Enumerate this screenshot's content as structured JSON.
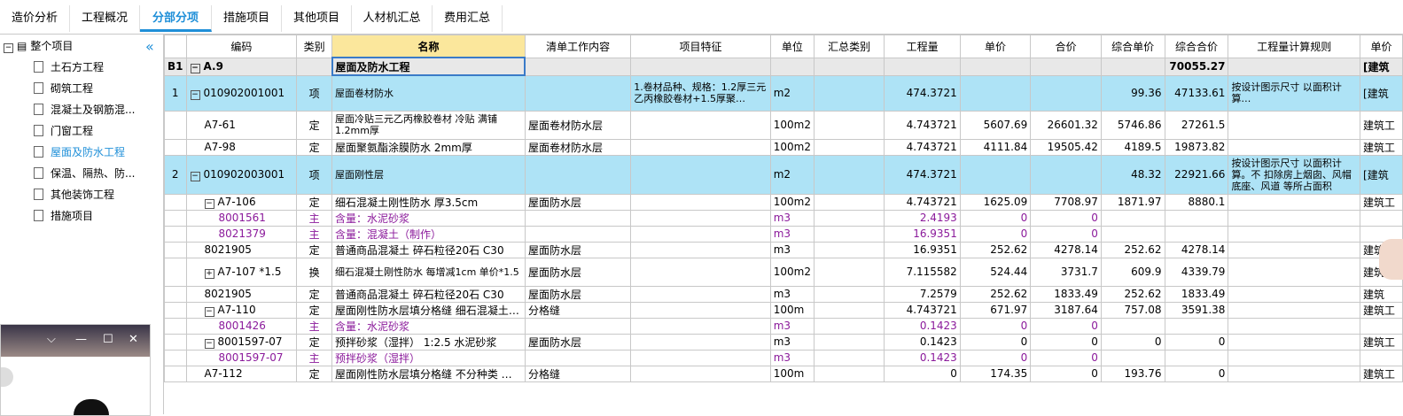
{
  "tabs": [
    "造价分析",
    "工程概况",
    "分部分项",
    "措施项目",
    "其他项目",
    "人材机汇总",
    "费用汇总"
  ],
  "active_tab": "分部分项",
  "tree": {
    "root": "整个项目",
    "items": [
      "土石方工程",
      "砌筑工程",
      "混凝土及钢筋混...",
      "门窗工程",
      "屋面及防水工程",
      "保温、隔热、防...",
      "其他装饰工程",
      "措施项目"
    ],
    "selected": "屋面及防水工程"
  },
  "columns": [
    "",
    "编码",
    "类别",
    "名称",
    "清单工作内容",
    "项目特征",
    "单位",
    "汇总类别",
    "工程量",
    "单价",
    "合价",
    "综合单价",
    "综合合价",
    "工程量计算规则",
    "单价"
  ],
  "rows": [
    {
      "idx": "B1",
      "code": "A.9",
      "type": "",
      "name": "屋面及防水工程",
      "work": "",
      "feature": "",
      "unit": "",
      "sum": "",
      "qty": "",
      "price": "",
      "total": "",
      "cprice": "",
      "ctotal": "70055.27",
      "rule": "",
      "extra": "[建筑"
    },
    {
      "idx": "1",
      "code": "010902001001",
      "type": "项",
      "name": "屋面卷材防水",
      "work": "",
      "feature": "1.卷材品种、规格：1.2厚三元乙丙橡胶卷材+1.5厚聚…",
      "unit": "m2",
      "sum": "",
      "qty": "474.3721",
      "price": "",
      "total": "",
      "cprice": "99.36",
      "ctotal": "47133.61",
      "rule": "按设计图示尺寸 以面积计算…",
      "extra": "[建筑"
    },
    {
      "idx": "",
      "code": "A7-61",
      "type": "定",
      "name": "屋面冷贴三元乙丙橡胶卷材 冷贴 满铺 1.2mm厚",
      "work": "屋面卷材防水层",
      "feature": "",
      "unit": "100m2",
      "sum": "",
      "qty": "4.743721",
      "price": "5607.69",
      "total": "26601.32",
      "cprice": "5746.86",
      "ctotal": "27261.5",
      "rule": "",
      "extra": "建筑工"
    },
    {
      "idx": "",
      "code": "A7-98",
      "type": "定",
      "name": "屋面聚氨酯涂膜防水 2mm厚",
      "work": "屋面卷材防水层",
      "feature": "",
      "unit": "100m2",
      "sum": "",
      "qty": "4.743721",
      "price": "4111.84",
      "total": "19505.42",
      "cprice": "4189.5",
      "ctotal": "19873.82",
      "rule": "",
      "extra": "建筑工"
    },
    {
      "idx": "2",
      "code": "010902003001",
      "type": "项",
      "name": "屋面刚性层",
      "work": "",
      "feature": "",
      "unit": "m2",
      "sum": "",
      "qty": "474.3721",
      "price": "",
      "total": "",
      "cprice": "48.32",
      "ctotal": "22921.66",
      "rule": "按设计图示尺寸 以面积计算。不 扣除房上烟囱、风帽底座、风道 等所占面积",
      "extra": "[建筑"
    },
    {
      "idx": "",
      "code": "A7-106",
      "type": "定",
      "name": "细石混凝土刚性防水 厚3.5cm",
      "work": "屋面防水层",
      "feature": "",
      "unit": "100m2",
      "sum": "",
      "qty": "4.743721",
      "price": "1625.09",
      "total": "7708.97",
      "cprice": "1871.97",
      "ctotal": "8880.1",
      "rule": "",
      "extra": "建筑工"
    },
    {
      "idx": "",
      "code": "8001561",
      "type": "主",
      "name": "含量：水泥砂浆",
      "work": "",
      "feature": "",
      "unit": "m3",
      "sum": "",
      "qty": "2.4193",
      "price": "0",
      "total": "0",
      "cprice": "",
      "ctotal": "",
      "rule": "",
      "extra": ""
    },
    {
      "idx": "",
      "code": "8021379",
      "type": "主",
      "name": "含量：混凝土（制作）",
      "work": "",
      "feature": "",
      "unit": "m3",
      "sum": "",
      "qty": "16.9351",
      "price": "0",
      "total": "0",
      "cprice": "",
      "ctotal": "",
      "rule": "",
      "extra": ""
    },
    {
      "idx": "",
      "code": "8021905",
      "type": "定",
      "name": "普通商品混凝土 碎石粒径20石 C30",
      "work": "屋面防水层",
      "feature": "",
      "unit": "m3",
      "sum": "",
      "qty": "16.9351",
      "price": "252.62",
      "total": "4278.14",
      "cprice": "252.62",
      "ctotal": "4278.14",
      "rule": "",
      "extra": "建筑"
    },
    {
      "idx": "",
      "code": "A7-107 *1.5",
      "type": "换",
      "name": "细石混凝土刚性防水 每增减1cm 单价*1.5",
      "work": "屋面防水层",
      "feature": "",
      "unit": "100m2",
      "sum": "",
      "qty": "7.115582",
      "price": "524.44",
      "total": "3731.7",
      "cprice": "609.9",
      "ctotal": "4339.79",
      "rule": "",
      "extra": "建筑"
    },
    {
      "idx": "",
      "code": "8021905",
      "type": "定",
      "name": "普通商品混凝土 碎石粒径20石 C30",
      "work": "屋面防水层",
      "feature": "",
      "unit": "m3",
      "sum": "",
      "qty": "7.2579",
      "price": "252.62",
      "total": "1833.49",
      "cprice": "252.62",
      "ctotal": "1833.49",
      "rule": "",
      "extra": "建筑"
    },
    {
      "idx": "",
      "code": "A7-110",
      "type": "定",
      "name": "屋面刚性防水层填分格缝 细石混凝土…",
      "work": "分格缝",
      "feature": "",
      "unit": "100m",
      "sum": "",
      "qty": "4.743721",
      "price": "671.97",
      "total": "3187.64",
      "cprice": "757.08",
      "ctotal": "3591.38",
      "rule": "",
      "extra": "建筑工"
    },
    {
      "idx": "",
      "code": "8001426",
      "type": "主",
      "name": "含量：水泥砂浆",
      "work": "",
      "feature": "",
      "unit": "m3",
      "sum": "",
      "qty": "0.1423",
      "price": "0",
      "total": "0",
      "cprice": "",
      "ctotal": "",
      "rule": "",
      "extra": ""
    },
    {
      "idx": "",
      "code": "8001597-07",
      "type": "定",
      "name": "预拌砂浆（湿拌） 1:2.5 水泥砂浆",
      "work": "屋面防水层",
      "feature": "",
      "unit": "m3",
      "sum": "",
      "qty": "0.1423",
      "price": "0",
      "total": "0",
      "cprice": "0",
      "ctotal": "0",
      "rule": "",
      "extra": "建筑工"
    },
    {
      "idx": "",
      "code": "8001597-07",
      "type": "主",
      "name": "预拌砂浆（湿拌）",
      "work": "",
      "feature": "",
      "unit": "m3",
      "sum": "",
      "qty": "0.1423",
      "price": "0",
      "total": "0",
      "cprice": "",
      "ctotal": "",
      "rule": "",
      "extra": ""
    },
    {
      "idx": "",
      "code": "A7-112",
      "type": "定",
      "name": "屋面刚性防水层填分格缝 不分种类 …",
      "work": "分格缝",
      "feature": "",
      "unit": "100m",
      "sum": "",
      "qty": "0",
      "price": "174.35",
      "total": "0",
      "cprice": "193.76",
      "ctotal": "0",
      "rule": "",
      "extra": "建筑工"
    }
  ]
}
